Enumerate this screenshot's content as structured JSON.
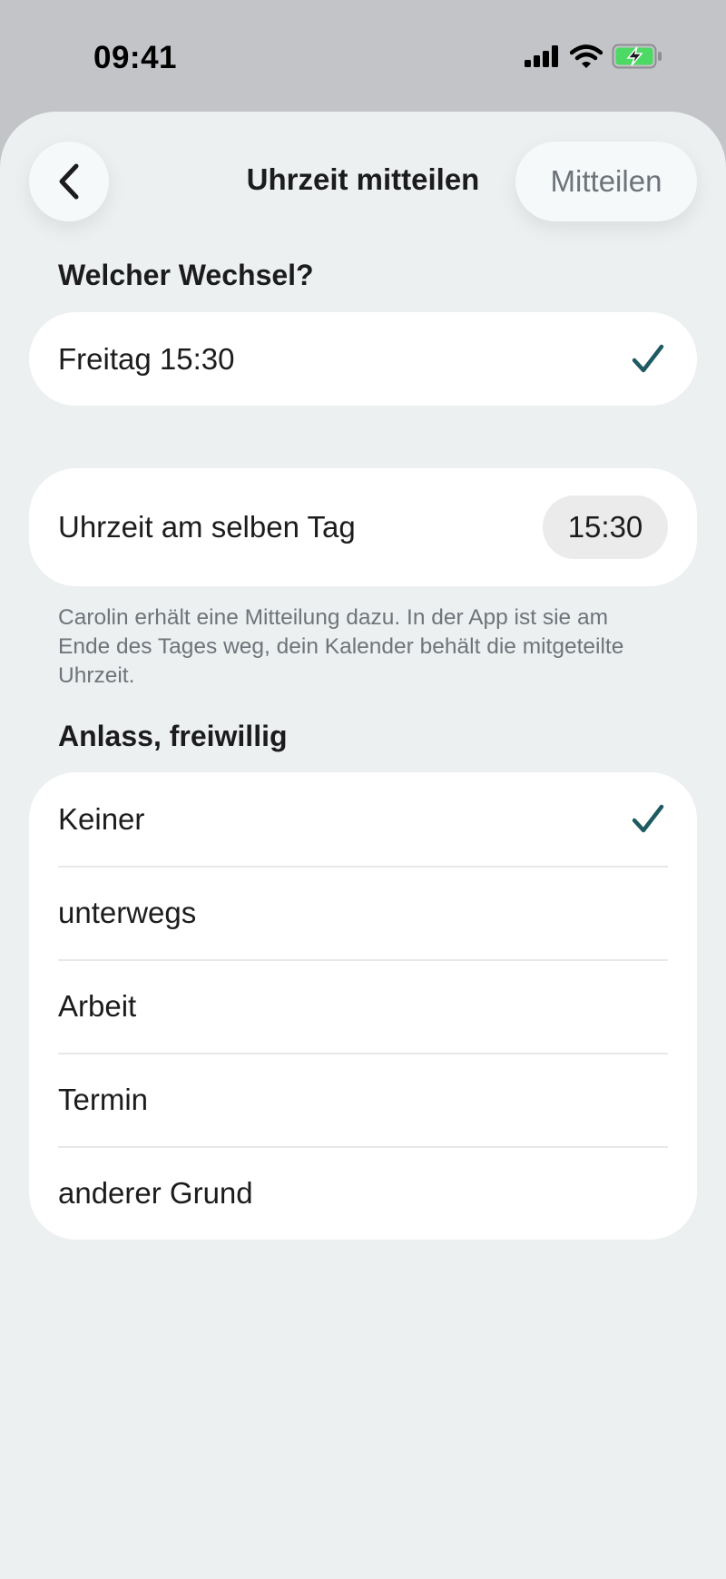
{
  "status": {
    "time": "09:41"
  },
  "nav": {
    "title": "Uhrzeit mitteilen",
    "submit_label": "Mitteilen"
  },
  "change_section": {
    "label": "Welcher Wechsel?",
    "selected": "Freitag 15:30"
  },
  "time_section": {
    "label": "Uhrzeit am selben Tag",
    "value": "15:30",
    "footnote": "Carolin erhält eine Mitteilung dazu. In der App ist sie am Ende des Tages weg, dein Kalender behält die mitgeteilte Uhrzeit."
  },
  "reason_section": {
    "label": "Anlass, freiwillig",
    "options": [
      {
        "label": "Keiner",
        "selected": true
      },
      {
        "label": "unterwegs",
        "selected": false
      },
      {
        "label": "Arbeit",
        "selected": false
      },
      {
        "label": "Termin",
        "selected": false
      },
      {
        "label": "anderer Grund",
        "selected": false
      }
    ]
  },
  "colors": {
    "accent": "#1f5a63",
    "sheet_bg": "#edf0f1",
    "card_bg": "#ffffff"
  },
  "icons": {
    "back": "chevron-left-icon",
    "check": "checkmark-icon"
  }
}
